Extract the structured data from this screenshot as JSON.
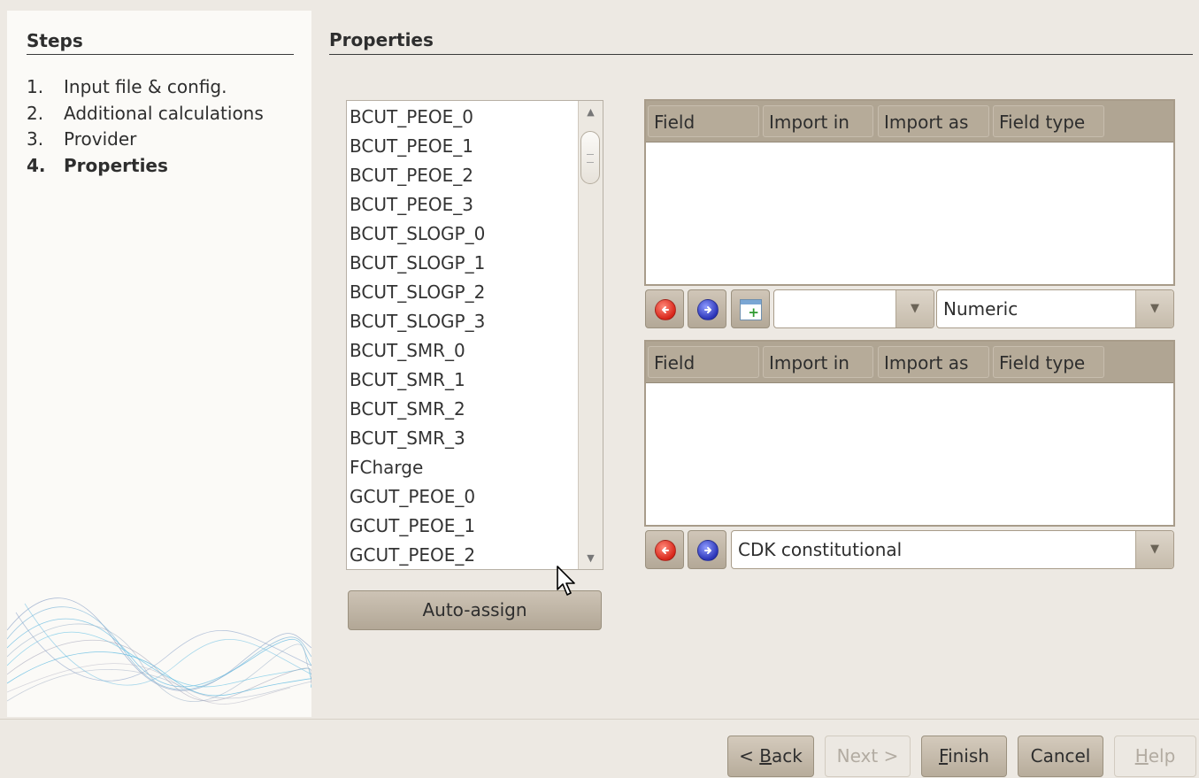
{
  "sidebar": {
    "heading": "Steps",
    "steps": [
      {
        "num": "1.",
        "label": "Input file & config."
      },
      {
        "num": "2.",
        "label": "Additional calculations"
      },
      {
        "num": "3.",
        "label": "Provider"
      },
      {
        "num": "4.",
        "label": "Properties"
      }
    ]
  },
  "main": {
    "title": "Properties",
    "property_list": [
      "BCUT_PEOE_0",
      "BCUT_PEOE_1",
      "BCUT_PEOE_2",
      "BCUT_PEOE_3",
      "BCUT_SLOGP_0",
      "BCUT_SLOGP_1",
      "BCUT_SLOGP_2",
      "BCUT_SLOGP_3",
      "BCUT_SMR_0",
      "BCUT_SMR_1",
      "BCUT_SMR_2",
      "BCUT_SMR_3",
      "FCharge",
      "GCUT_PEOE_0",
      "GCUT_PEOE_1",
      "GCUT_PEOE_2"
    ],
    "auto_assign_label": "Auto-assign",
    "table1": {
      "columns": [
        "Field",
        "Import in",
        "Import as",
        "Field type"
      ],
      "rows": []
    },
    "toolbar1": {
      "import_in_value": "",
      "field_type_value": "Numeric"
    },
    "table2": {
      "columns": [
        "Field",
        "Import in",
        "Import as",
        "Field type"
      ],
      "rows": []
    },
    "toolbar2": {
      "provider_value": "CDK constitutional"
    }
  },
  "footer": {
    "back": {
      "pre": "< ",
      "mnemonic": "B",
      "post": "ack"
    },
    "next": "Next >",
    "finish": {
      "pre": "",
      "mnemonic": "F",
      "post": "inish"
    },
    "cancel": "Cancel",
    "help": {
      "pre": "",
      "mnemonic": "H",
      "post": "elp"
    }
  },
  "icons": {
    "remove": "red-left-arrow-icon",
    "add": "blue-right-arrow-icon",
    "new_field": "add-table-field-icon"
  },
  "colors": {
    "sidebar_bg": "#fbfaf7",
    "window_bg": "#ede9e3",
    "header_bg": "#b0a593",
    "button_bg": "#c3b9a9"
  }
}
